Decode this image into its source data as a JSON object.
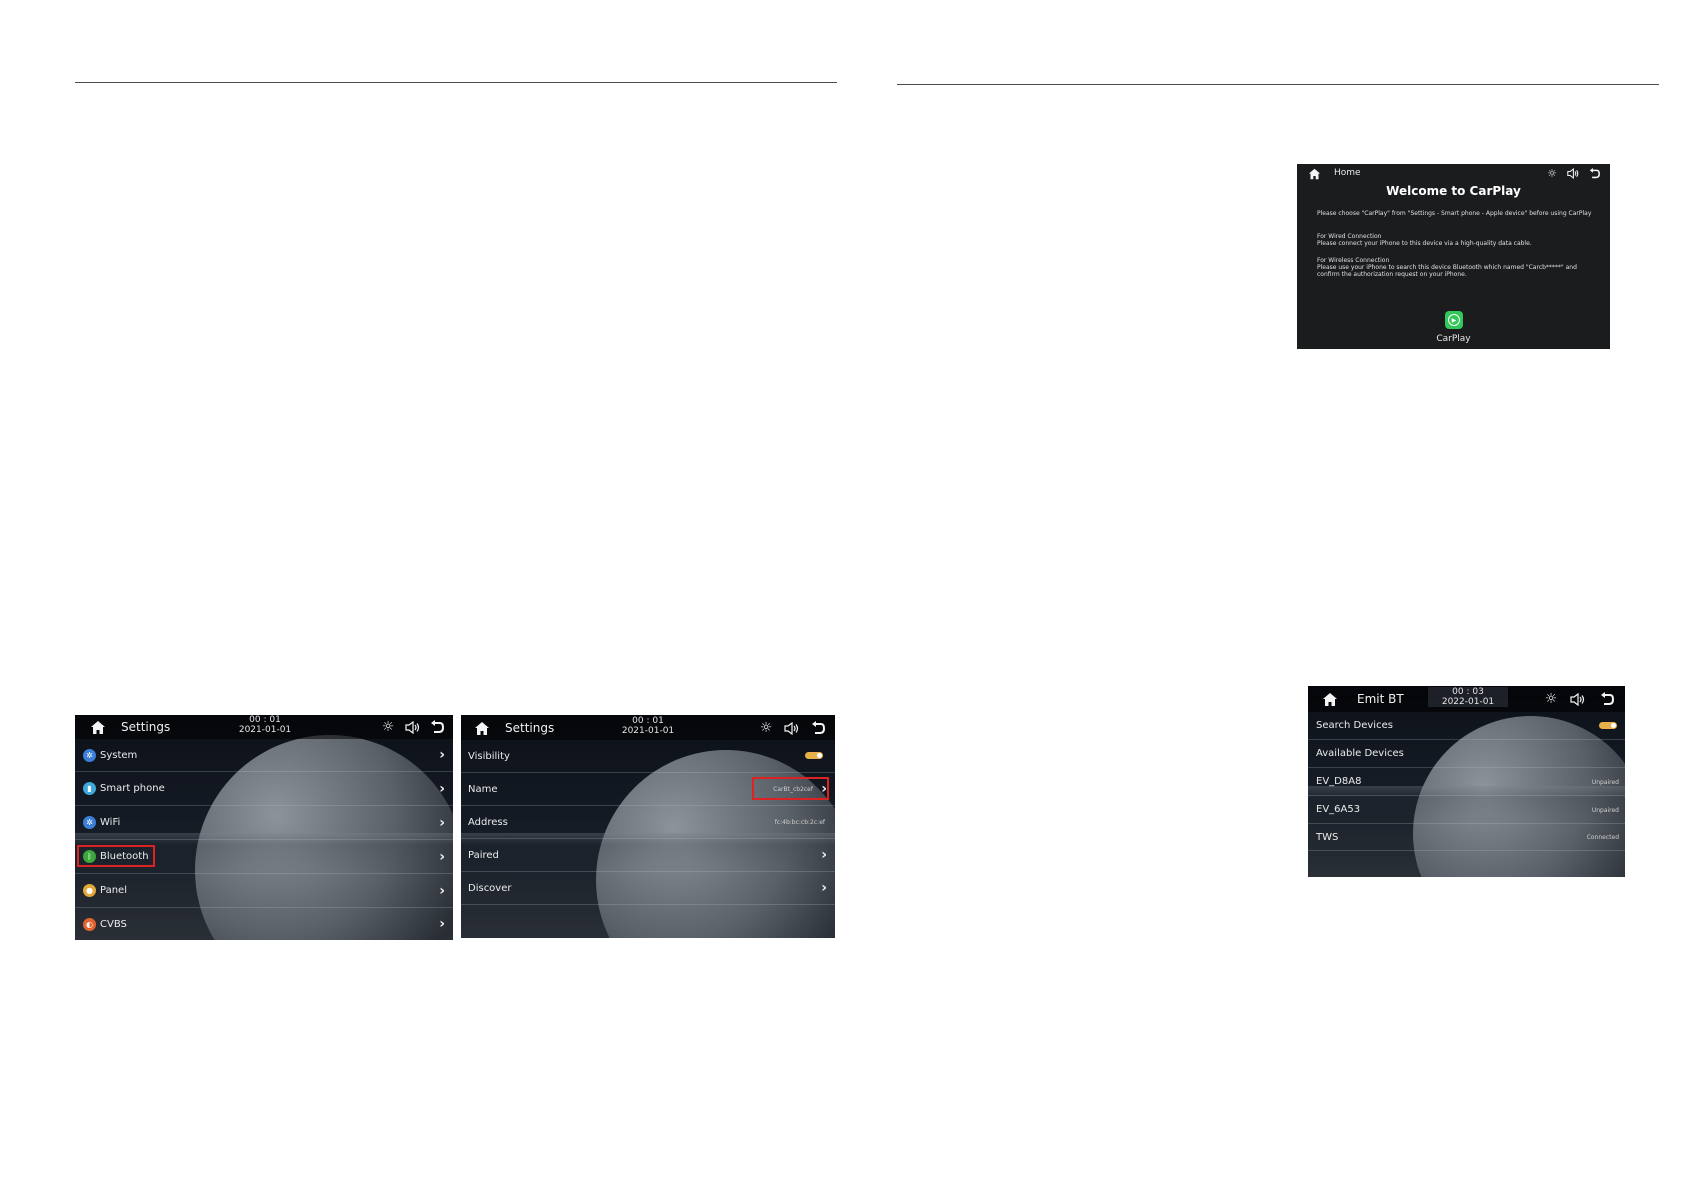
{
  "colors": {
    "accent_toggle": "#e7b04a",
    "highlight": "#dd2222",
    "carplay_green": "#34c759"
  },
  "screen1": {
    "title": "Settings",
    "time": "00 : 01",
    "date": "2021-01-01",
    "items": [
      {
        "label": "System",
        "icon": "gear-icon",
        "color": "#3b7fd9"
      },
      {
        "label": "Smart phone",
        "icon": "phone-icon",
        "color": "#3fa7d9"
      },
      {
        "label": "WiFi",
        "icon": "gear-icon",
        "color": "#3b7fd9"
      },
      {
        "label": "Bluetooth",
        "icon": "bluetooth-icon",
        "color": "#3aa83a"
      },
      {
        "label": "Panel",
        "icon": "panel-icon",
        "color": "#e0a93a"
      },
      {
        "label": "CVBS",
        "icon": "cvbs-icon",
        "color": "#e3632e"
      }
    ]
  },
  "screen2": {
    "title": "Settings",
    "time": "00 : 01",
    "date": "2021-01-01",
    "rows": [
      {
        "label": "Visibility"
      },
      {
        "label": "Name",
        "value": "CarBt_cb2cef"
      },
      {
        "label": "Address",
        "value": "fc:4b:bc:cb:2c:ef"
      },
      {
        "label": "Paired"
      },
      {
        "label": "Discover"
      }
    ]
  },
  "screen3": {
    "title": "Home",
    "heading": "Welcome to CarPlay",
    "line1": "Please choose \"CarPlay\" from \"Settings - Smart phone - Apple device\" before using CarPlay",
    "wired_title": "For Wired Connection",
    "wired_text": "Please connect your iPhone to this device via a high-quality data cable.",
    "wireless_title": "For Wireless Connection",
    "wireless_text1": "Please use your iPhone to search this device Bluetooth which named \"Carcb*****\" and",
    "wireless_text2": "confirm the authorization request on your iPhone.",
    "app_label": "CarPlay"
  },
  "screen4": {
    "title": "Emit BT",
    "time": "00 : 03",
    "date": "2022-01-01",
    "rows": [
      {
        "label": "Search Devices"
      },
      {
        "label": "Available Devices"
      },
      {
        "label": "EV_D8A8",
        "status": "Unpaired"
      },
      {
        "label": "EV_6A53",
        "status": "Unpaired"
      },
      {
        "label": "TWS",
        "status": "Connected"
      }
    ]
  }
}
